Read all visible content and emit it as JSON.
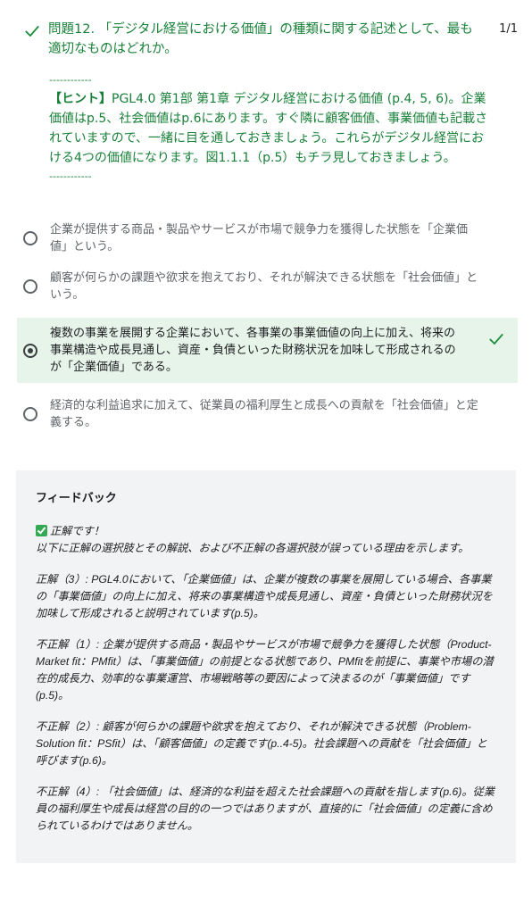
{
  "question": {
    "title": "問題12. 「デジタル経営における価値」の種類に関する記述として、最も適切なものはどれか。",
    "score": "1/1",
    "hint_sep_top": "------------",
    "hint_label": "【ヒント】",
    "hint_body": "PGL4.0 第1部 第1章 デジタル経営における価値 (p.4, 5, 6)。企業価値はp.5、社会価値はp.6にあります。すぐ隣に顧客価値、事業価値も記載されていますので、一緒に目を通しておきましょう。これらがデジタル経営における4つの価値になります。図1.1.1（p.5）もチラ見しておきましょう。",
    "hint_sep_bottom": "------------"
  },
  "options": [
    {
      "text": "企業が提供する商品・製品やサービスが市場で競争力を獲得した状態を「企業価値」という。"
    },
    {
      "text": "顧客が何らかの課題や欲求を抱えており、それが解決できる状態を「社会価値」という。"
    },
    {
      "text": "複数の事業を展開する企業において、各事業の事業価値の向上に加え、将来の事業構造や成長見通し、資産・負債といった財務状況を加味して形成されるのが「企業価値」である。"
    },
    {
      "text": "経済的な利益追求に加えて、従業員の福利厚生と成長への貢献を「社会価値」と定義する。"
    }
  ],
  "selected_index": 2,
  "feedback": {
    "title": "フィードバック",
    "correct": "正解です！",
    "intro": "以下に正解の選択肢とその解説、および不正解の各選択肢が誤っている理由を示します。",
    "p1": "正解（3）: PGL4.0において、「企業価値」は、企業が複数の事業を展開している場合、各事業の「事業価値」の向上に加え、将来の事業構造や成長見通し、資産・負債といった財務状況を加味して形成されると説明されています(p.5)。",
    "p2": "不正解（1）: 企業が提供する商品・製品やサービスが市場で競争力を獲得した状態（Product-Market fit：PMfit）は、「事業価値」の前提となる状態であり、PMfitを前提に、事業や市場の潜在的成長力、効率的な事業運営、市場戦略等の要因によって決まるのが「事業価値」です(p.5)。",
    "p3": "不正解（2）: 顧客が何らかの課題や欲求を抱えており、それが解決できる状態（Problem-Solution fit：PSfit）は、「顧客価値」の定義です(p..4-5)。社会課題への貢献を「社会価値」と呼びます(p.6)。",
    "p4": "不正解（4）: 「社会価値」は、経済的な利益を超えた社会課題への貢献を指します(p.6)。従業員の福利厚生や成長は経営の目的の一つではありますが、直接的に「社会価値」の定義に含められているわけではありません。"
  },
  "colors": {
    "correct_green": "#188038",
    "selected_bg": "#e6f4ea",
    "feedback_bg": "#f1f3f4"
  }
}
